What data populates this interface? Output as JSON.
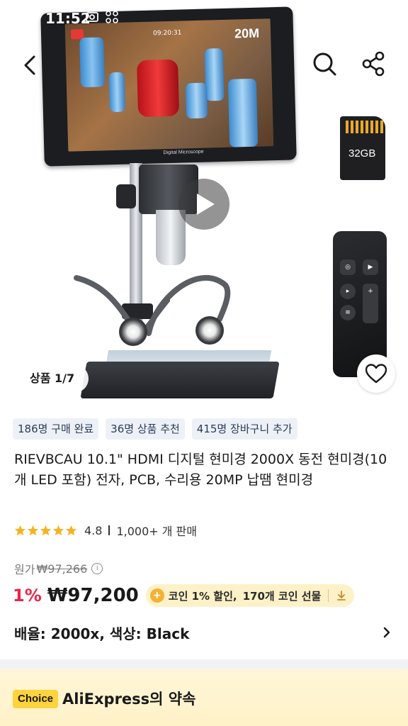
{
  "status_bar": {
    "time": "11:52"
  },
  "media": {
    "screen_time": "09:20:31",
    "screen_resolution": "20M",
    "monitor_label": "Digital Microscope",
    "sd_card_label": "32GB",
    "image_counter": "상품 1/7"
  },
  "social_proof": [
    {
      "label": "186명 구매 완료"
    },
    {
      "label": "36명 상품 추천"
    },
    {
      "label": "415명 장바구니 추가"
    }
  ],
  "product": {
    "title": "RIEVBCAU 10.1\" HDMI 디지털 현미경 2000X 동전 현미경(10개 LED 포함) 전자, PCB, 수리용 20MP 납땜 현미경",
    "rating": "4.8",
    "rating_stars": 5,
    "sold": "1,000+ 개 판매"
  },
  "price": {
    "original_label": "원가",
    "original": "₩97,266",
    "discount": "1%",
    "current": "₩97,200",
    "coin_discount": "코인 1% 할인,",
    "coin_gift": "170개 코인 선물"
  },
  "variant": {
    "label": "배율: 2000x, 색상: Black"
  },
  "promise": {
    "badge": "Choice",
    "title": "AliExpress의 약속"
  },
  "colors": {
    "discount": "#e8264a",
    "chip_bg": "#edf1f7",
    "coin_pill_bg": "#fdf1c8",
    "star": "#f5b321",
    "choice_yellow": "#ffd33d"
  }
}
